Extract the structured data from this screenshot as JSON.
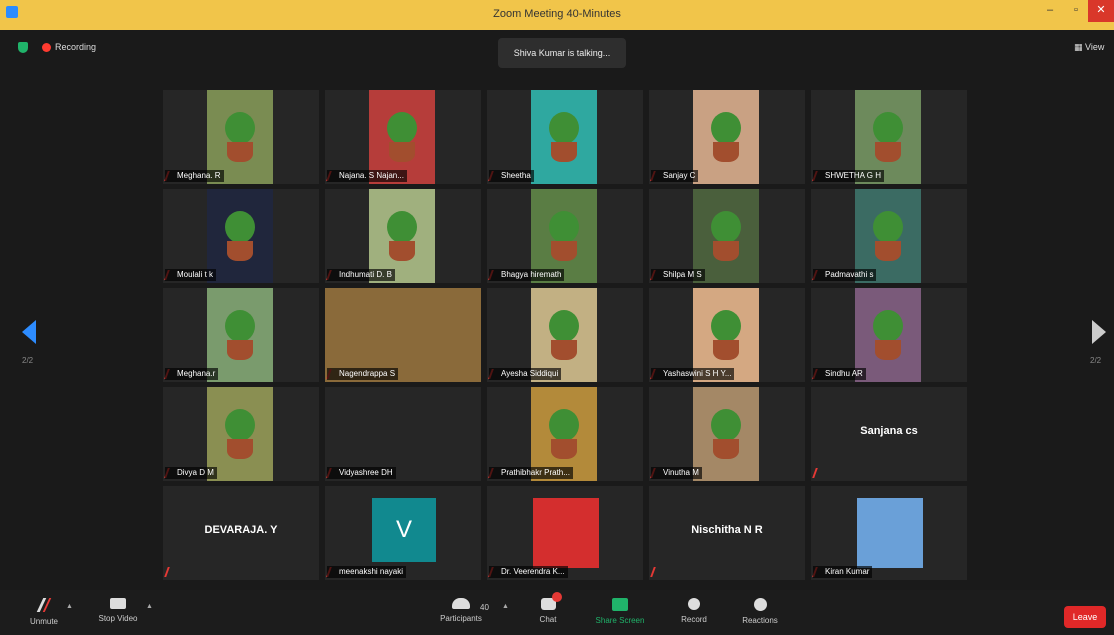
{
  "window": {
    "title": "Zoom Meeting 40-Minutes",
    "min": "–",
    "max": "▫",
    "close": "✕"
  },
  "recording": {
    "label": "Recording"
  },
  "speaking": {
    "text": "Shiva Kumar is talking..."
  },
  "view": {
    "label": "View",
    "icon": "grid-view-icon"
  },
  "pagination": {
    "left": "2/2",
    "right": "2/2"
  },
  "participants": [
    {
      "name": "Meghana. R",
      "type": "video",
      "bg": "#7a8c52"
    },
    {
      "name": "Najana. S Najan...",
      "type": "video",
      "bg": "#b63d3a"
    },
    {
      "name": "Sheetha",
      "type": "video",
      "bg": "#2fa8a0"
    },
    {
      "name": "Sanjay C",
      "type": "video",
      "bg": "#c9a183"
    },
    {
      "name": "SHWETHA G H",
      "type": "video",
      "bg": "#6d8a5c"
    },
    {
      "name": "Moulali t k",
      "type": "video",
      "bg": "#20263c"
    },
    {
      "name": "Indhumati D. B",
      "type": "video",
      "bg": "#a0b07e"
    },
    {
      "name": "Bhagya hiremath",
      "type": "video",
      "bg": "#5a7d44"
    },
    {
      "name": "Shilpa M S",
      "type": "video",
      "bg": "#4a5f3c"
    },
    {
      "name": "Padmavathi s",
      "type": "video",
      "bg": "#3b6b63"
    },
    {
      "name": "Meghana.r",
      "type": "video",
      "bg": "#7a9b6d"
    },
    {
      "name": "Nagendrappa S",
      "type": "video",
      "bg": "#8a6a3a"
    },
    {
      "name": "Ayesha Siddiqui",
      "type": "video",
      "bg": "#c2b083"
    },
    {
      "name": "Yashaswini S H Y...",
      "type": "video",
      "bg": "#d4a882"
    },
    {
      "name": "Sindhu AR",
      "type": "video",
      "bg": "#7a5a7a"
    },
    {
      "name": "Divya D M",
      "type": "video",
      "bg": "#8a8f52"
    },
    {
      "name": "Vidyashree DH",
      "type": "blank",
      "bg": "#262626"
    },
    {
      "name": "Prathibhakr Prath...",
      "type": "video",
      "bg": "#b38a3a"
    },
    {
      "name": "Vinutha M",
      "type": "video",
      "bg": "#a48866"
    },
    {
      "name": "Sanjana cs",
      "type": "text",
      "bg": "#262626"
    },
    {
      "name": "DEVARAJA. Y",
      "type": "text",
      "bg": "#262626"
    },
    {
      "name": "meenakshi nayaki",
      "type": "avatar",
      "initial": "V",
      "bg": "#262626"
    },
    {
      "name": "Dr. Veerendra K...",
      "type": "photo",
      "bg": "#d42e2e"
    },
    {
      "name": "Nischitha N R",
      "type": "text",
      "bg": "#262626"
    },
    {
      "name": "Kiran Kumar",
      "type": "photo",
      "bg": "#6aa0d8"
    }
  ],
  "toolbar": {
    "unmute": "Unmute",
    "stop_video": "Stop Video",
    "participants": "Participants",
    "participant_count": "40",
    "chat": "Chat",
    "share_screen": "Share Screen",
    "record": "Record",
    "reactions": "Reactions",
    "leave": "Leave"
  }
}
